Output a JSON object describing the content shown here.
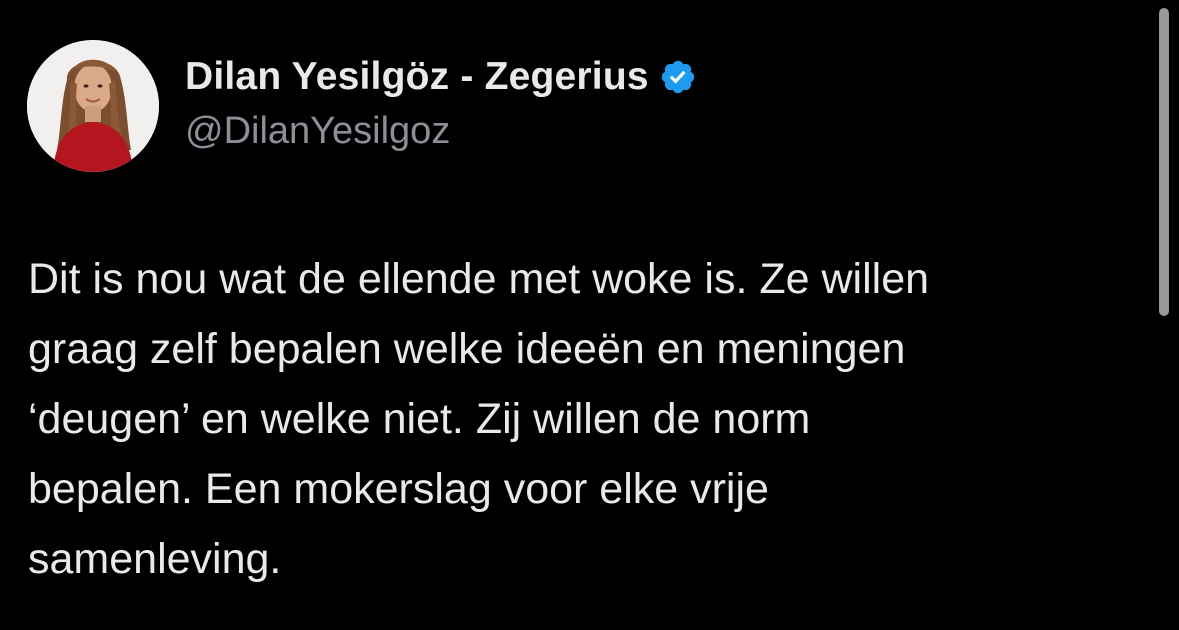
{
  "profile": {
    "display_name": "Dilan Yesilgöz - Zegerius",
    "handle": "@DilanYesilgoz",
    "verified_icon": "verified-badge-icon",
    "avatar_icon": "profile-avatar"
  },
  "tweet": {
    "lines": [
      "Dit is nou wat de ellende met woke is. Ze willen",
      "graag zelf bepalen welke ideeën en meningen",
      "‘deugen’ en welke niet. Zij willen de norm",
      "bepalen. Een mokerslag voor elke vrije",
      "samenleving."
    ]
  },
  "colors": {
    "background": "#000000",
    "text_primary": "#e7e9ea",
    "text_secondary": "#8b9096",
    "verified_blue": "#1d9bf0",
    "scrollbar": "#9a9a9a"
  }
}
